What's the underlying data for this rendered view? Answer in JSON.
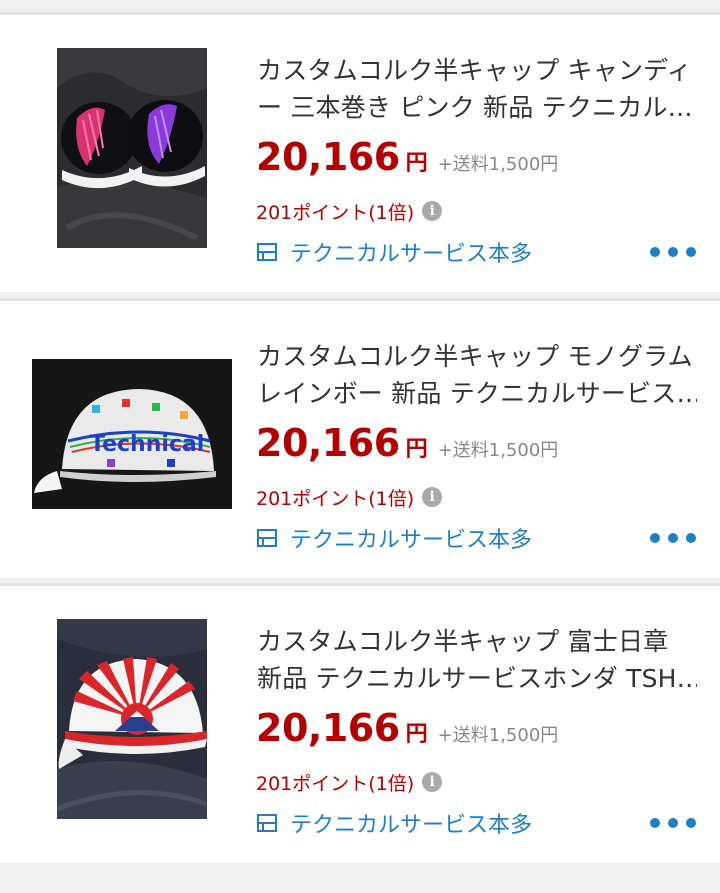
{
  "colors": {
    "price": "#b00000",
    "shop_link": "#1f7fc4",
    "divider": "#e2e2e2",
    "background": "#f1f1f1"
  },
  "items": [
    {
      "title_line1": "カスタムコルク半キャップ キャンディ",
      "title_line2": "ー 三本巻き ピンク 新品 テクニカル…",
      "price": "20,166",
      "yen": "円",
      "shipping": "+送料1,500円",
      "points": "201ポイント(1倍)",
      "info_icon": "i",
      "shop_icon": "shop-icon",
      "shop": "テクニカルサービス本多",
      "more_icon": "more-icon"
    },
    {
      "title_line1": "カスタムコルク半キャップ モノグラム",
      "title_line2": "レインボー 新品 テクニカルサービス…",
      "price": "20,166",
      "yen": "円",
      "shipping": "+送料1,500円",
      "points": "201ポイント(1倍)",
      "info_icon": "i",
      "shop_icon": "shop-icon",
      "shop": "テクニカルサービス本多",
      "more_icon": "more-icon"
    },
    {
      "title_line1": "カスタムコルク半キャップ 富士日章",
      "title_line2": "新品 テクニカルサービスホンダ TSH…",
      "price": "20,166",
      "yen": "円",
      "shipping": "+送料1,500円",
      "points": "201ポイント(1倍)",
      "info_icon": "i",
      "shop_icon": "shop-icon",
      "shop": "テクニカルサービス本多",
      "more_icon": "more-icon"
    }
  ],
  "images": {
    "item2_logo_text": "Technical"
  }
}
